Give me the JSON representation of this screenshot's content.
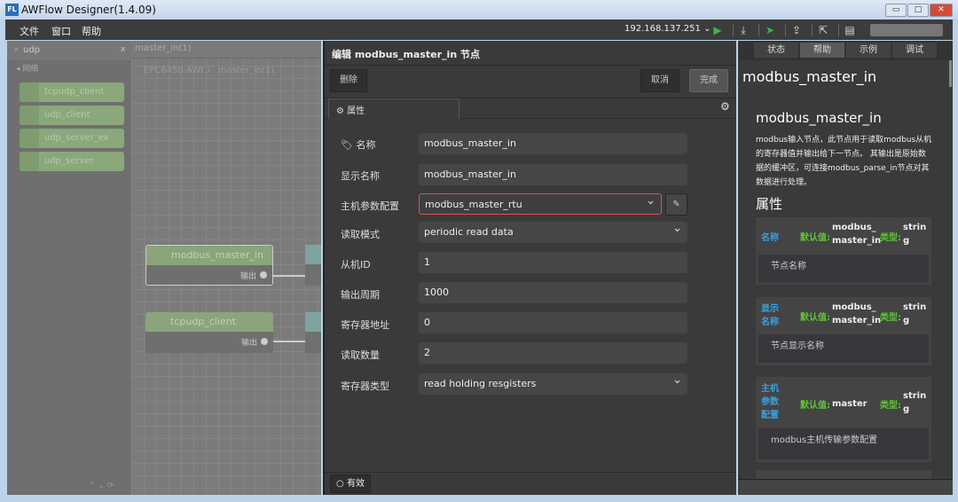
{
  "window": {
    "title": "AWFlow Designer(1.4.09)",
    "logo": "FL",
    "min": "▭",
    "max": "□",
    "close": "✕"
  },
  "menu": [
    "文件",
    "窗口",
    "帮助"
  ],
  "toolbar": {
    "ip": "192.168.137.251 ⌄",
    "icons": [
      "play-icon",
      "download-icon",
      "deploy-icon",
      "upload-icon",
      "export-icon",
      "clipboard-icon"
    ]
  },
  "palette": {
    "search": "udp",
    "clear": "x",
    "category": "网络",
    "nodes": [
      "tcpudp_client",
      "udp_client",
      "udp_server_ex",
      "udp_server"
    ]
  },
  "canvas": {
    "tab": "master_in(1)",
    "breadcrumb": [
      "EPC6450-AWI",
      "master_in(1)"
    ],
    "nodes": [
      {
        "label": "modbus_master_in",
        "port": "输出"
      },
      {
        "label": "tcpudp_client",
        "port": "输出"
      }
    ]
  },
  "editor": {
    "title": "编辑 modbus_master_in 节点",
    "delete": "删除",
    "cancel": "取消",
    "done": "完成",
    "tab": "属性",
    "enabled": "有效",
    "fields": [
      {
        "label": "名称",
        "value": "modbus_master_in"
      },
      {
        "label": "显示名称",
        "value": "modbus_master_in"
      },
      {
        "label": "主机参数配置",
        "value": "modbus_master_rtu"
      },
      {
        "label": "读取模式",
        "value": "periodic read data"
      },
      {
        "label": "从机ID",
        "value": "1"
      },
      {
        "label": "输出周期",
        "value": "1000"
      },
      {
        "label": "寄存器地址",
        "value": "0"
      },
      {
        "label": "读取数量",
        "value": "2"
      },
      {
        "label": "寄存器类型",
        "value": "read holding resgisters"
      }
    ]
  },
  "help": {
    "tabs": [
      "状态",
      "帮助",
      "示例",
      "调试"
    ],
    "title": "modbus_master_in",
    "subtitle": "modbus_master_in",
    "description": "modbus输入节点，此节点用于读取modbus从机的寄存器值并输出给下一节点。 其输出是原始数据的缓冲区，可连接modbus_parse_in节点对其数据进行处理。",
    "props_heading": "属性",
    "default_label": "默认值:",
    "type_label": "类型:",
    "props": [
      {
        "name": "名称",
        "default": "modbus_ master_in",
        "type": "strin g",
        "desc": "节点名称"
      },
      {
        "name": "显示 名称",
        "default": "modbus_ master_in",
        "type": "strin g",
        "desc": "节点显示名称"
      },
      {
        "name": "主机 参数 配置",
        "default": "master",
        "type": "strin g",
        "desc": "modbus主机传输参数配置"
      }
    ]
  }
}
